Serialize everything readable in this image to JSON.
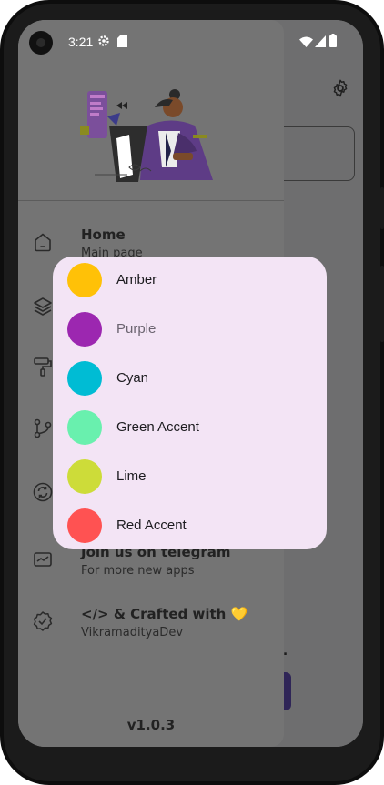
{
  "status_bar": {
    "time": "3:21"
  },
  "drawer": {
    "menu": [
      {
        "icon": "home-icon",
        "title": "Home",
        "subtitle": "Main page"
      },
      {
        "icon": "layers-icon",
        "title": "",
        "subtitle": ""
      },
      {
        "icon": "paint-roller-icon",
        "title": "",
        "subtitle": ""
      },
      {
        "icon": "git-branch-icon",
        "title": "",
        "subtitle": ""
      },
      {
        "icon": "sync-icon",
        "title": "",
        "subtitle": ""
      },
      {
        "icon": "telegram-icon",
        "title": "Join us on telegram",
        "subtitle": "For more new apps"
      },
      {
        "icon": "verified-icon",
        "title": "</> & Crafted with 💛",
        "subtitle": "VikramadityaDev"
      }
    ],
    "version": "v1.0.3"
  },
  "background": {
    "partial_text": "y."
  },
  "color_dialog": {
    "options": [
      {
        "label": "Amber",
        "color": "#FFC107"
      },
      {
        "label": "Purple",
        "color": "#9C27B0"
      },
      {
        "label": "Cyan",
        "color": "#00BCD4"
      },
      {
        "label": "Green Accent",
        "color": "#69F0AE"
      },
      {
        "label": "Lime",
        "color": "#CDDC39"
      },
      {
        "label": "Red Accent",
        "color": "#FF5252"
      }
    ],
    "selected": "Purple"
  },
  "colors": {
    "scrim": "#6e6e6f",
    "dialog_bg": "#f3e4f5",
    "selected_text": "#6b6470",
    "option_text": "#1c1b1f"
  }
}
